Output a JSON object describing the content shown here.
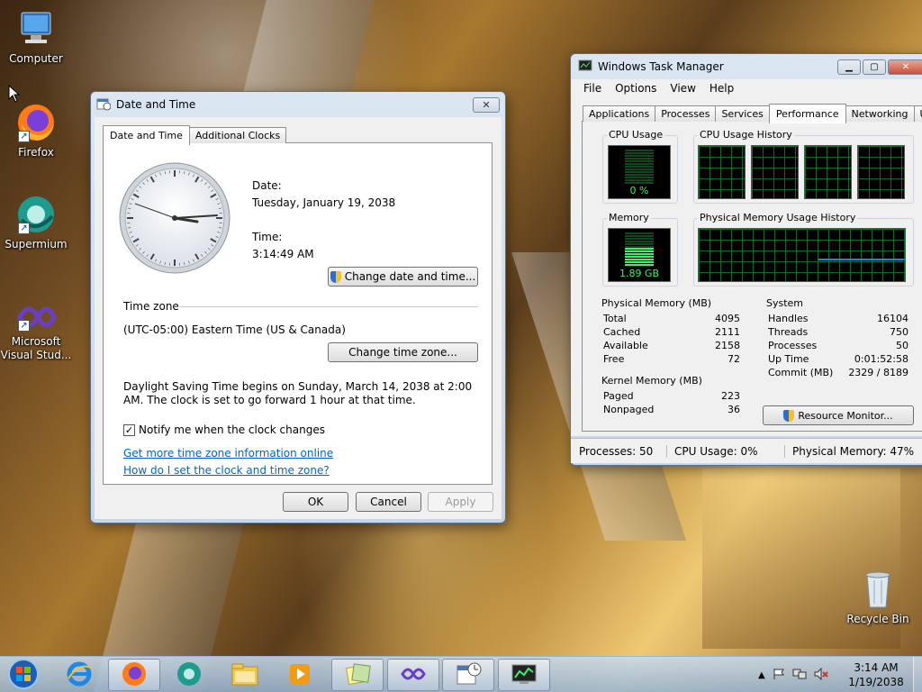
{
  "desktop": {
    "icons": [
      {
        "label": "Computer",
        "icon": "computer-icon"
      },
      {
        "label": "Firefox",
        "icon": "firefox-icon"
      },
      {
        "label": "Supermium",
        "icon": "supermium-icon"
      },
      {
        "label_line1": "Microsoft",
        "label_line2": "Visual Stud...",
        "icon": "visual-studio-icon"
      },
      {
        "label": "Recycle Bin",
        "icon": "recycle-bin-icon"
      }
    ]
  },
  "datetime": {
    "title": "Date and Time",
    "tabs": [
      "Date and Time",
      "Additional Clocks"
    ],
    "date_label": "Date:",
    "date_value": "Tuesday, January 19, 2038",
    "time_label": "Time:",
    "time_value": "3:14:49 AM",
    "change_date_button": "Change date and time...",
    "timezone_header": "Time zone",
    "timezone_value": "(UTC-05:00) Eastern Time (US & Canada)",
    "change_tz_button": "Change time zone...",
    "dst_text": "Daylight Saving Time begins on Sunday, March 14, 2038 at 2:00 AM. The clock is set to go forward 1 hour at that time.",
    "notify_label": "Notify me when the clock changes",
    "notify_checked": true,
    "link1": "Get more time zone information online",
    "link2": "How do I set the clock and time zone?",
    "ok": "OK",
    "cancel": "Cancel",
    "apply": "Apply"
  },
  "taskmgr": {
    "title": "Windows Task Manager",
    "menu": [
      "File",
      "Options",
      "View",
      "Help"
    ],
    "tabs": [
      "Applications",
      "Processes",
      "Services",
      "Performance",
      "Networking",
      "Users"
    ],
    "active_tab": "Performance",
    "cpu_usage_label": "CPU Usage",
    "cpu_usage_value": "0 %",
    "cpu_history_label": "CPU Usage History",
    "memory_label": "Memory",
    "memory_value": "1.89 GB",
    "phys_history_label": "Physical Memory Usage History",
    "physical": {
      "header": "Physical Memory (MB)",
      "rows": [
        [
          "Total",
          "4095"
        ],
        [
          "Cached",
          "2111"
        ],
        [
          "Available",
          "2158"
        ],
        [
          "Free",
          "72"
        ]
      ]
    },
    "kernel": {
      "header": "Kernel Memory (MB)",
      "rows": [
        [
          "Paged",
          "223"
        ],
        [
          "Nonpaged",
          "36"
        ]
      ]
    },
    "system": {
      "header": "System",
      "rows": [
        [
          "Handles",
          "16104"
        ],
        [
          "Threads",
          "750"
        ],
        [
          "Processes",
          "50"
        ],
        [
          "Up Time",
          "0:01:52:58"
        ],
        [
          "Commit (MB)",
          "2329 / 8189"
        ]
      ]
    },
    "resource_monitor_button": "Resource Monitor...",
    "status": {
      "processes": "Processes: 50",
      "cpu": "CPU Usage: 0%",
      "memory": "Physical Memory: 47%"
    }
  },
  "taskbar": {
    "clock_time": "3:14 AM",
    "clock_date": "1/19/2038",
    "pinned": [
      "start-orb-icon",
      "internet-explorer-icon",
      "firefox-icon",
      "supermium-icon",
      "file-explorer-icon",
      "media-player-icon",
      "sticky-notes-icon",
      "visual-studio-icon",
      "date-time-icon",
      "task-manager-icon"
    ]
  },
  "colors": {
    "accent": "#0066cc",
    "graph_green": "#3cf06a",
    "grid": "#0a6b2c"
  }
}
